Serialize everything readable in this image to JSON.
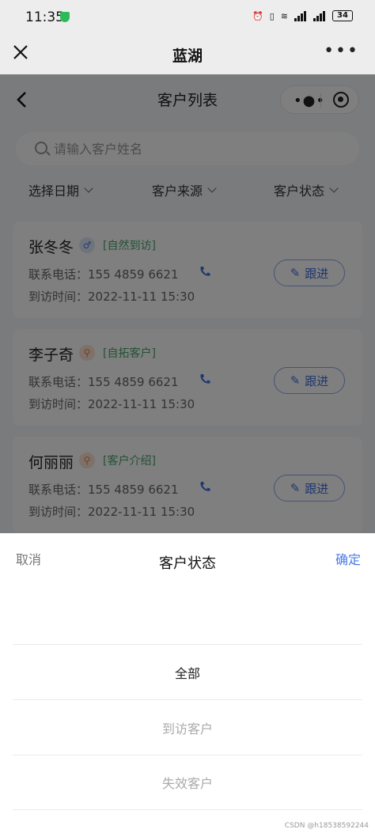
{
  "status_bar": {
    "time": "11:35",
    "battery": "34"
  },
  "app_bar": {
    "title": "蓝湖"
  },
  "page": {
    "title": "客户列表",
    "search": {
      "placeholder": "请输入客户姓名"
    },
    "filters": [
      {
        "label": "选择日期"
      },
      {
        "label": "客户来源"
      },
      {
        "label": "客户状态"
      }
    ],
    "customers": [
      {
        "name": "张冬冬",
        "gender_icon": "male-icon",
        "source": "[自然到访]",
        "phone_label": "联系电话：155 4859 6621",
        "visit_label": "到访时间：2022-11-11  15:30",
        "action": "跟进"
      },
      {
        "name": "李子奇",
        "gender_icon": "search-icon",
        "source": "[自拓客户]",
        "phone_label": "联系电话：155 4859 6621",
        "visit_label": "到访时间：2022-11-11  15:30",
        "action": "跟进"
      },
      {
        "name": "何丽丽",
        "gender_icon": "search-icon",
        "source": "[客户介绍]",
        "phone_label": "联系电话：155 4859 6621",
        "visit_label": "到访时间：2022-11-11  15:30",
        "action": "跟进"
      }
    ]
  },
  "picker": {
    "cancel": "取消",
    "title": "客户状态",
    "confirm": "确定",
    "options": [
      "全部",
      "到访客户",
      "失效客户"
    ],
    "selected": "全部"
  },
  "watermark": "CSDN @h18538592244",
  "colors": {
    "accent": "#4a7be6",
    "tag_green": "#48a56a",
    "mask": "rgba(0,0,0,0.5)"
  }
}
